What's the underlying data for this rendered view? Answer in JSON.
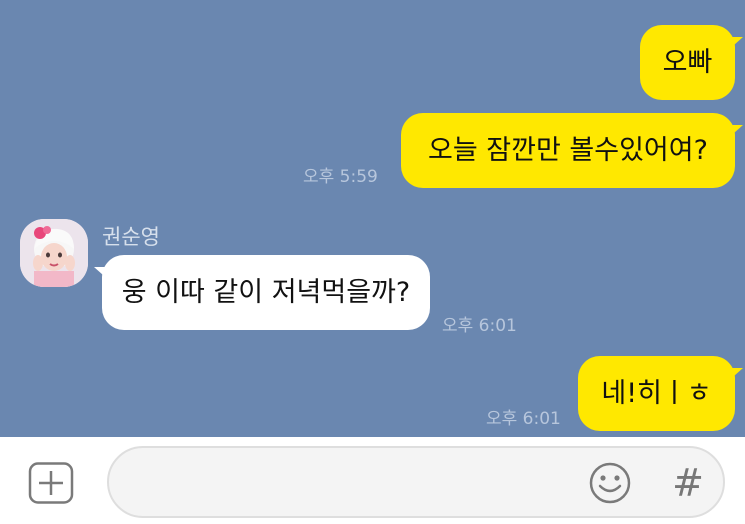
{
  "messages": [
    {
      "side": "me",
      "text": "오빠",
      "time": ""
    },
    {
      "side": "me",
      "text": "오늘 잠깐만 볼수있어여?",
      "time": "오후 5:59"
    },
    {
      "side": "other",
      "sender": "권순영",
      "text": "웅 이따 같이 저녁먹을까?",
      "time": "오후 6:01"
    },
    {
      "side": "me",
      "text": "네!히ㅣㅎ",
      "time": "오후 6:01"
    }
  ],
  "input": {
    "placeholder": "",
    "value": ""
  },
  "icons": {
    "attach": "plus-square-icon",
    "emoji": "smiley-icon",
    "hashtag": "hashtag-icon"
  },
  "hashtag_glyph": "#",
  "colors": {
    "chat_background": "#6a87b0",
    "my_bubble": "#ffe800",
    "other_bubble": "#ffffff"
  }
}
